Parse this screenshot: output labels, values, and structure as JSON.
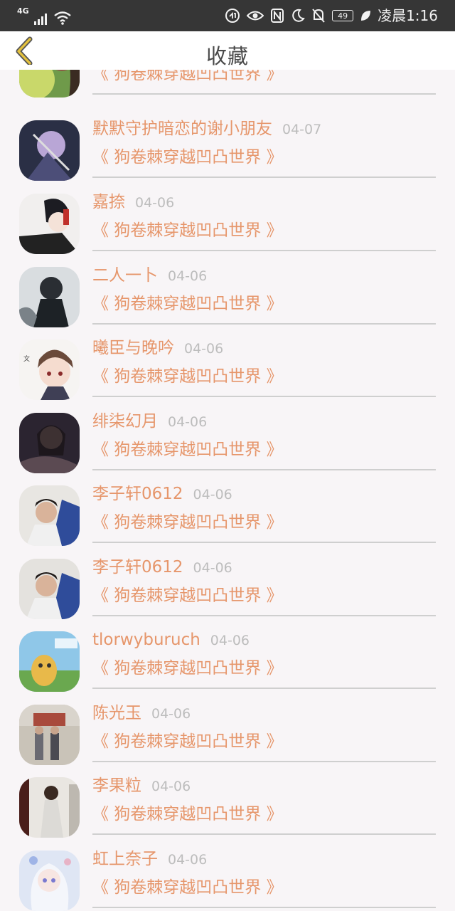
{
  "status_bar": {
    "network": "4G",
    "battery": "49",
    "time": "凌晨1:16"
  },
  "header": {
    "title": "收藏",
    "back_icon": "chevron-left-icon",
    "accent_color": "#e3c13e"
  },
  "colors": {
    "name": "#e6966b",
    "book": "#e6966b",
    "date": "#bdbdbd",
    "background": "#f8f5f7"
  },
  "items": [
    {
      "name": "",
      "date": "",
      "book": "《 狗卷棘穿越凹凸世界 》"
    },
    {
      "name": "默默守护暗恋的谢小朋友",
      "date": "04-07",
      "book": "《 狗卷棘穿越凹凸世界 》"
    },
    {
      "name": "嘉捺",
      "date": "04-06",
      "book": "《 狗卷棘穿越凹凸世界 》"
    },
    {
      "name": "二人一卜",
      "date": "04-06",
      "book": "《 狗卷棘穿越凹凸世界 》"
    },
    {
      "name": "曦臣与晚吟",
      "date": "04-06",
      "book": "《 狗卷棘穿越凹凸世界 》"
    },
    {
      "name": "绯柒幻月",
      "date": "04-06",
      "book": "《 狗卷棘穿越凹凸世界 》"
    },
    {
      "name": "李子轩0612",
      "date": "04-06",
      "book": "《 狗卷棘穿越凹凸世界 》"
    },
    {
      "name": "李子轩0612",
      "date": "04-06",
      "book": "《 狗卷棘穿越凹凸世界 》"
    },
    {
      "name": "tlorwyburuch",
      "date": "04-06",
      "book": "《 狗卷棘穿越凹凸世界 》"
    },
    {
      "name": "陈光玉",
      "date": "04-06",
      "book": "《 狗卷棘穿越凹凸世界 》"
    },
    {
      "name": "李果粒",
      "date": "04-06",
      "book": "《 狗卷棘穿越凹凸世界 》"
    },
    {
      "name": "虹上奈子",
      "date": "04-06",
      "book": "《 狗卷棘穿越凹凸世界 》"
    }
  ]
}
